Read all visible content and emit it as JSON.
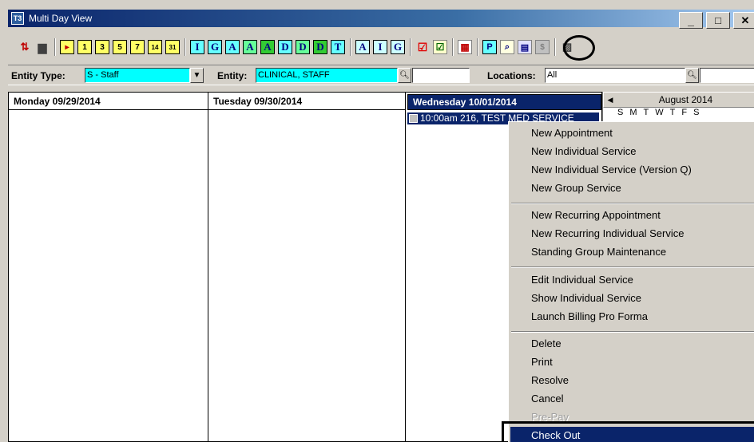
{
  "window": {
    "title": "Multi Day View",
    "app_icon": "T3"
  },
  "title_buttons": {
    "minimize": "_",
    "maximize": "□",
    "close": "✕"
  },
  "toolbar": {
    "yellow_buttons": [
      "1",
      "3",
      "5",
      "7",
      "14",
      "31"
    ],
    "letter_buttons_a": [
      "I",
      "G",
      "A",
      "A",
      "A",
      "D",
      "D",
      "D",
      "T"
    ],
    "letter_buttons_b": [
      "A",
      "I",
      "G"
    ]
  },
  "filters": {
    "entity_type_label": "Entity Type:",
    "entity_type_value": "S - Staff",
    "entity_label": "Entity:",
    "entity_value": "CLINICAL, STAFF",
    "locations_label": "Locations:",
    "locations_value": "All"
  },
  "calendar": {
    "days": [
      {
        "label": "Monday 09/29/2014",
        "selected": false
      },
      {
        "label": "Tuesday 09/30/2014",
        "selected": false
      },
      {
        "label": "Wednesday 10/01/2014",
        "selected": true
      }
    ],
    "appointment": "10:00am 216, TEST MED SERVICE"
  },
  "mini_month": {
    "title": "August 2014",
    "weekday_letters": [
      "S",
      "M",
      "T",
      "W",
      "T",
      "F",
      "S"
    ]
  },
  "context_menu": {
    "groups": [
      [
        "New Appointment",
        "New Individual Service",
        "New Individual Service (Version Q)",
        "New Group Service"
      ],
      [
        "New Recurring Appointment",
        "New Recurring Individual Service",
        "Standing Group Maintenance"
      ],
      [
        "Edit Individual Service",
        "Show Individual Service",
        "Launch Billing Pro Forma"
      ],
      [
        "Delete",
        "Print",
        "Resolve",
        "Cancel"
      ]
    ],
    "disabled_item": "Pre-Pay",
    "highlighted_item": "Check Out"
  }
}
